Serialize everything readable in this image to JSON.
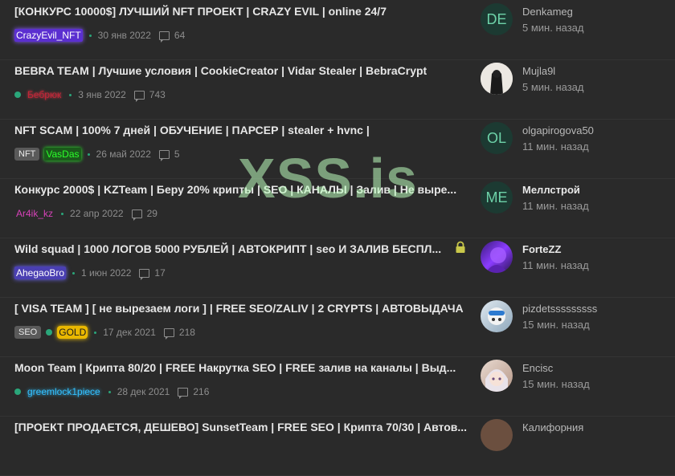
{
  "watermark": "XSS.is",
  "threads": [
    {
      "title": "[КОНКУРС 10000$] ЛУЧШИЙ NFT ПРОЕКТ | CRAZY EVIL | online 24/7",
      "tags": [],
      "author": "CrazyEvil_NFT",
      "date": "30 янв 2022",
      "replies": "64",
      "avatar_text": "DE",
      "last_user": "Denkameg",
      "last_time": "5 мин. назад"
    },
    {
      "title": "BEBRA TEAM | Лучшие условия | CookieCreator | Vidar Stealer | BebraCrypt",
      "tags": [],
      "author": "Бебрюк",
      "date": "3 янв 2022",
      "replies": "743",
      "avatar_text": "",
      "last_user": "Mujla9l",
      "last_time": "5 мин. назад"
    },
    {
      "title": "NFT SCAM | 100% 7 дней | ОБУЧЕНИЕ | ПАРСЕР | stealer + hvnc |",
      "tags": [
        "NFT"
      ],
      "author": "VasDas",
      "date": "26 май 2022",
      "replies": "5",
      "avatar_text": "OL",
      "last_user": "olgapirogova50",
      "last_time": "11 мин. назад"
    },
    {
      "title": "Конкурс 2000$ | KZTeam | Беру 20% крипты | SEO | КАНАЛЫ | Залив | Не выре...",
      "tags": [],
      "author": "Ar4ik_kz",
      "date": "22 апр 2022",
      "replies": "29",
      "avatar_text": "ME",
      "last_user": "Меллстрой",
      "last_time": "11 мин. назад"
    },
    {
      "title": "Wild squad | 1000 ЛОГОВ 5000 РУБЛЕЙ | АВТОКРИПТ | seo И ЗАЛИВ БЕСПЛ...",
      "tags": [],
      "author": "AhegaoBro",
      "date": "1 июн 2022",
      "replies": "17",
      "avatar_text": "",
      "last_user": "ForteZZ",
      "last_time": "11 мин. назад"
    },
    {
      "title": "[ VISA TEAM ] [ не вырезаем логи ] | FREE SEO/ZALIV | 2 CRYPTS | АВТОВЫДАЧА",
      "tags": [
        "SEO"
      ],
      "author": "GOLD",
      "date": "17 дек 2021",
      "replies": "218",
      "avatar_text": "",
      "last_user": "pizdetsssssssss",
      "last_time": "15 мин. назад"
    },
    {
      "title": "Moon Team | Крипта 80/20 | FREE Накрутка SEO | FREE залив на каналы | Выд...",
      "tags": [],
      "author": "greemlock1piece",
      "date": "28 дек 2021",
      "replies": "216",
      "avatar_text": "",
      "last_user": "Encisc",
      "last_time": "15 мин. назад"
    },
    {
      "title": "[ПРОЕКТ ПРОДАЕТСЯ, ДЕШЕВО] SunsetTeam | FREE SEO | Крипта 70/30 | Автов...",
      "tags": [],
      "author": "",
      "date": "",
      "replies": "",
      "avatar_text": "",
      "last_user": "Калифорния",
      "last_time": ""
    }
  ]
}
